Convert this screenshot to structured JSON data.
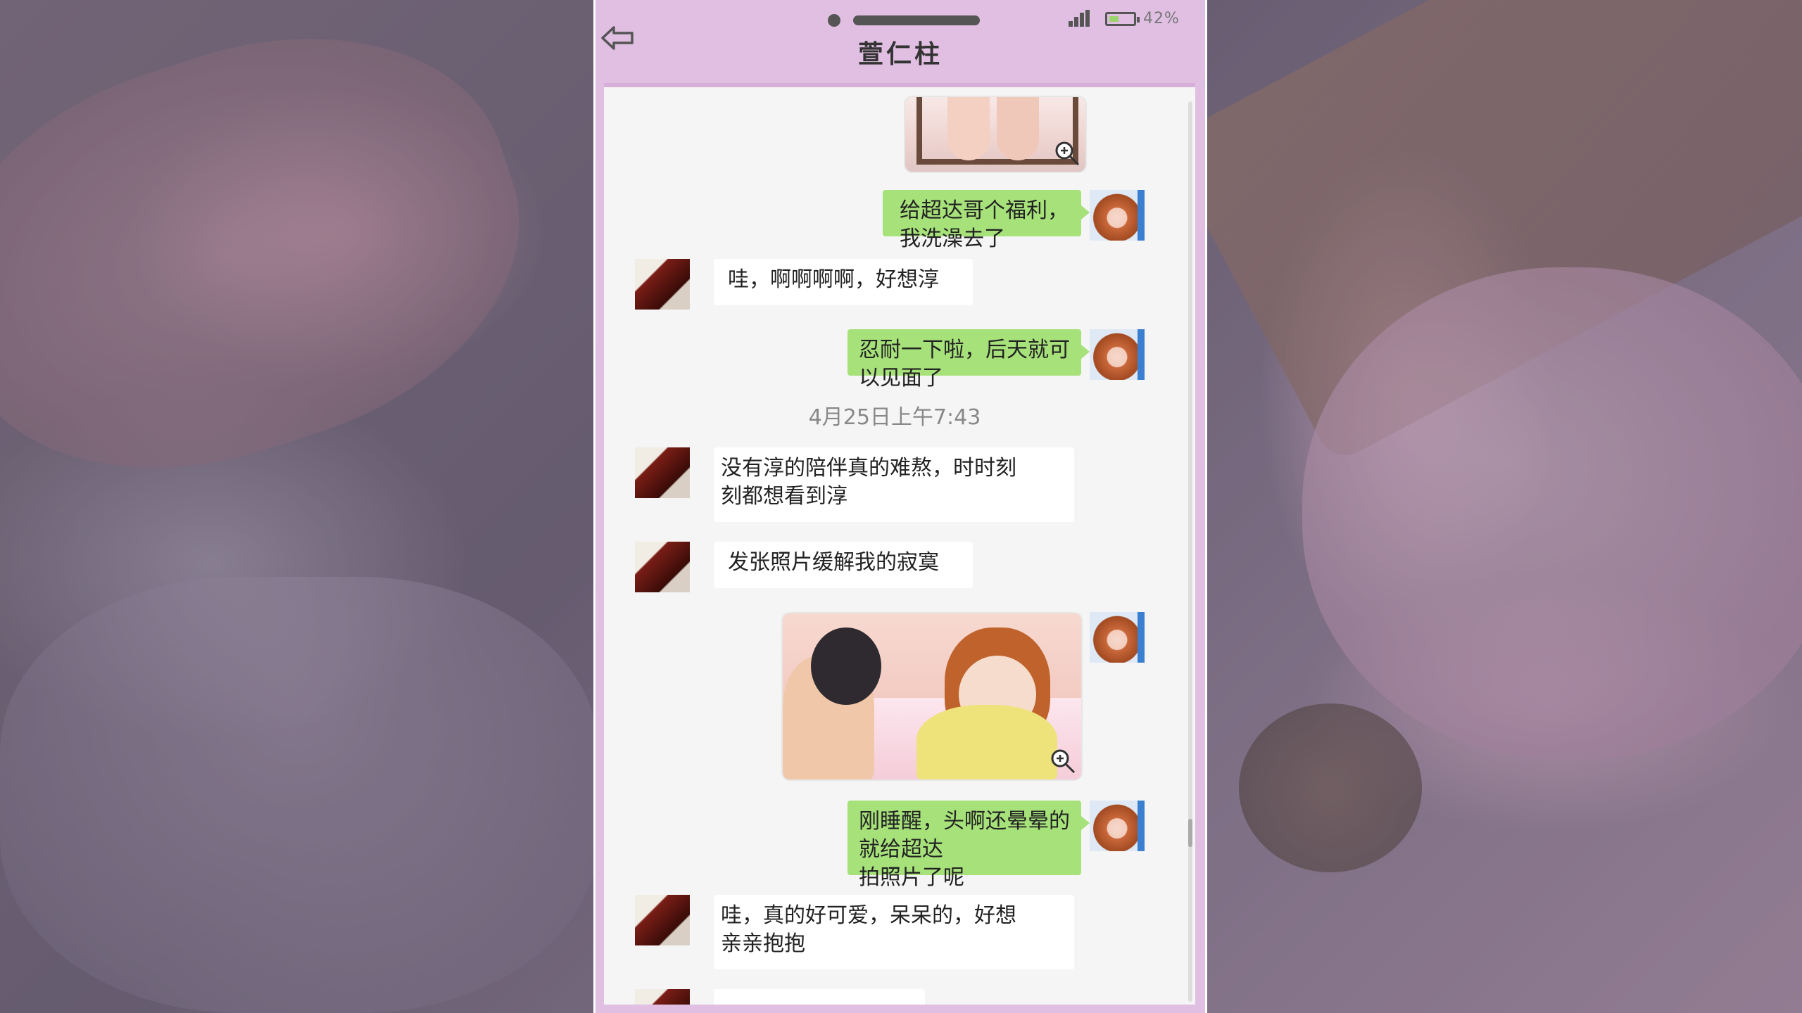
{
  "status_bar": {
    "battery_text": "42%",
    "battery_level": 0.42
  },
  "header": {
    "title": "萱仁柱",
    "back_icon": "back-arrow-icon"
  },
  "messages": [
    {
      "side": "out",
      "type": "image",
      "description": "cropped photo"
    },
    {
      "side": "out",
      "type": "text",
      "text": "给超达哥个福利，我洗澡去了"
    },
    {
      "side": "in",
      "type": "text",
      "text": "哇，啊啊啊啊，好想淳"
    },
    {
      "side": "out",
      "type": "text",
      "text": "忍耐一下啦，后天就可以见面了"
    },
    {
      "type": "timestamp",
      "text": "4月25日上午7:43"
    },
    {
      "side": "in",
      "type": "text",
      "text": "没有淳的陪伴真的难熬，时时刻\n刻都想看到淳"
    },
    {
      "side": "in",
      "type": "text",
      "text": "发张照片缓解我的寂寞"
    },
    {
      "side": "out",
      "type": "image"
    },
    {
      "side": "out",
      "type": "text",
      "text": "刚睡醒，头啊还晕晕的就给超达\n拍照片了呢"
    },
    {
      "side": "in",
      "type": "text",
      "text": "哇，真的好可爱，呆呆的，好想\n亲亲抱抱"
    }
  ],
  "colors": {
    "header_bg": "#e1bfe3",
    "bubble_out": "#a6e17a",
    "bubble_in": "#ffffff",
    "chat_bg": "#f5f5f5"
  }
}
